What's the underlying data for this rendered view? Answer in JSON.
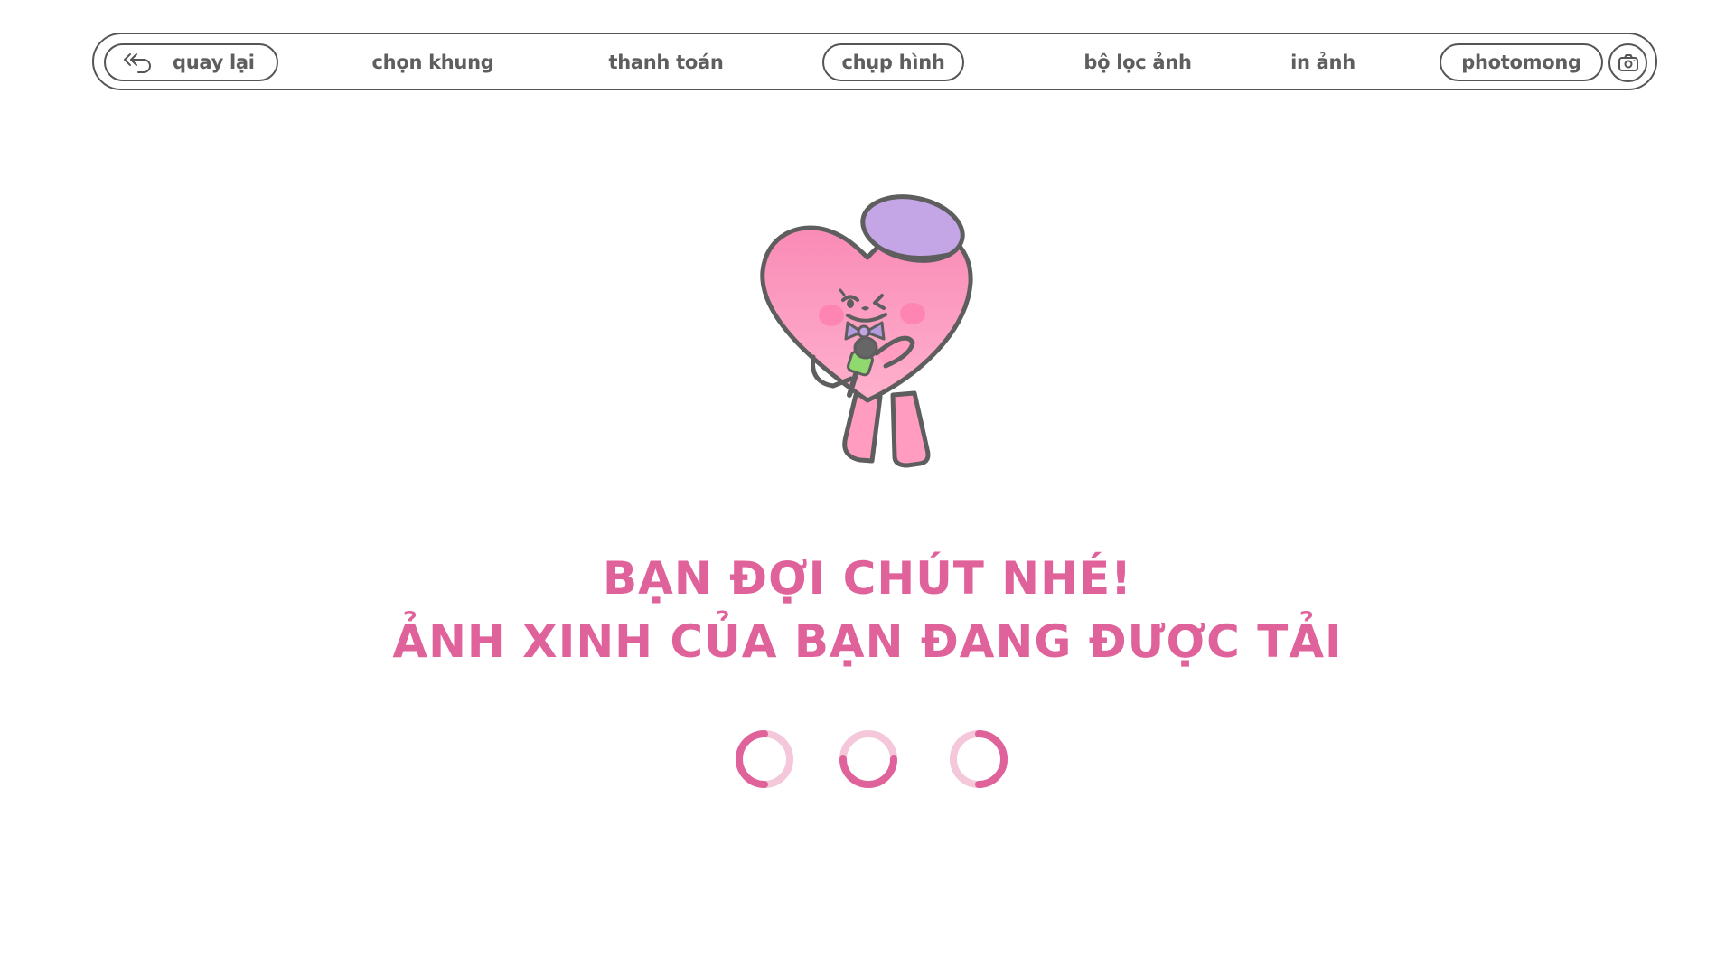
{
  "nav": {
    "back_label": "quay lại",
    "items": [
      {
        "label": "chọn khung"
      },
      {
        "label": "thanh toán"
      },
      {
        "label": "chụp hình",
        "active": true
      },
      {
        "label": "bộ lọc ảnh"
      },
      {
        "label": "in ảnh"
      }
    ],
    "brand": "photomong",
    "icons": {
      "back": "back-arrow-icon",
      "camera": "camera-icon"
    }
  },
  "main": {
    "headline_line1": "BẠN ĐỢI CHÚT NHÉ!",
    "headline_line2": "ẢNH XINH CỦA BẠN ĐANG ĐƯỢC TẢI",
    "mascot": "heart-mascot-with-microphone",
    "loading_indicators": 3
  },
  "colors": {
    "accent": "#e0629a",
    "outline": "#555555",
    "heart": "#ff9cbf",
    "beret": "#c4a6e6",
    "mic": "#8fd96e"
  }
}
